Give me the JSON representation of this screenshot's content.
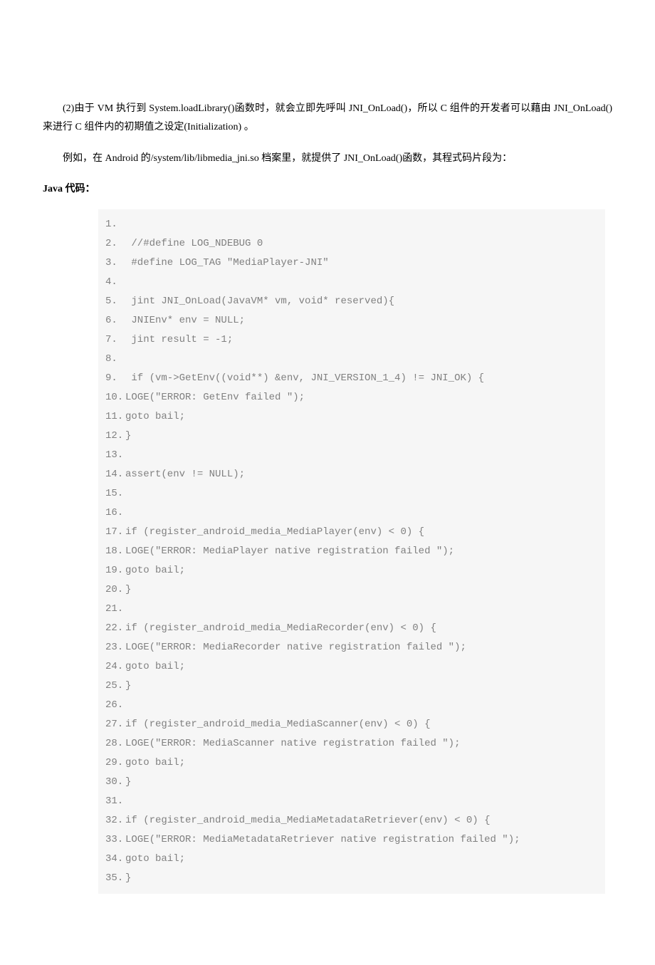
{
  "paragraph1": "(2)由于 VM 执行到 System.loadLibrary()函数时，就会立即先呼叫 JNI_OnLoad()，所以 C 组件的开发者可以藉由 JNI_OnLoad()来进行 C 组件内的初期值之设定(Initialization) 。",
  "paragraph2": "例如，在 Android 的/system/lib/libmedia_jni.so 档案里，就提供了 JNI_OnLoad()函数，其程式码片段为：",
  "javaLabel": "Java 代码：",
  "code": {
    "lines": [
      {
        "n": "1.",
        "t": ""
      },
      {
        "n": "2.",
        "t": " //#define LOG_NDEBUG 0"
      },
      {
        "n": "3.",
        "t": " #define LOG_TAG \"MediaPlayer-JNI\""
      },
      {
        "n": "4.",
        "t": ""
      },
      {
        "n": "5.",
        "t": " jint JNI_OnLoad(JavaVM* vm, void* reserved){"
      },
      {
        "n": "6.",
        "t": " JNIEnv* env = NULL;"
      },
      {
        "n": "7.",
        "t": " jint result = -1;"
      },
      {
        "n": "8.",
        "t": ""
      },
      {
        "n": "9.",
        "t": " if (vm->GetEnv((void**) &env, JNI_VERSION_1_4) != JNI_OK) {"
      },
      {
        "n": "10.",
        "t": "LOGE(\"ERROR: GetEnv failed \");"
      },
      {
        "n": "11.",
        "t": "goto bail;"
      },
      {
        "n": "12.",
        "t": "}"
      },
      {
        "n": "13.",
        "t": ""
      },
      {
        "n": "14.",
        "t": "assert(env != NULL);"
      },
      {
        "n": "15.",
        "t": ""
      },
      {
        "n": "16.",
        "t": ""
      },
      {
        "n": "17.",
        "t": "if (register_android_media_MediaPlayer(env) < 0) {"
      },
      {
        "n": "18.",
        "t": "LOGE(\"ERROR: MediaPlayer native registration failed \");"
      },
      {
        "n": "19.",
        "t": "goto bail;"
      },
      {
        "n": "20.",
        "t": "}"
      },
      {
        "n": "21.",
        "t": ""
      },
      {
        "n": "22.",
        "t": "if (register_android_media_MediaRecorder(env) < 0) {"
      },
      {
        "n": "23.",
        "t": "LOGE(\"ERROR: MediaRecorder native registration failed \");"
      },
      {
        "n": "24.",
        "t": "goto bail;"
      },
      {
        "n": "25.",
        "t": "}"
      },
      {
        "n": "26.",
        "t": ""
      },
      {
        "n": "27.",
        "t": "if (register_android_media_MediaScanner(env) < 0) {"
      },
      {
        "n": "28.",
        "t": "LOGE(\"ERROR: MediaScanner native registration failed \");"
      },
      {
        "n": "29.",
        "t": "goto bail;"
      },
      {
        "n": "30.",
        "t": "}"
      },
      {
        "n": "31.",
        "t": ""
      },
      {
        "n": "32.",
        "t": "if (register_android_media_MediaMetadataRetriever(env) < 0) {"
      },
      {
        "n": "33.",
        "t": "LOGE(\"ERROR: MediaMetadataRetriever native registration failed \");"
      },
      {
        "n": "34.",
        "t": "goto bail;"
      },
      {
        "n": "35.",
        "t": "}"
      }
    ]
  }
}
